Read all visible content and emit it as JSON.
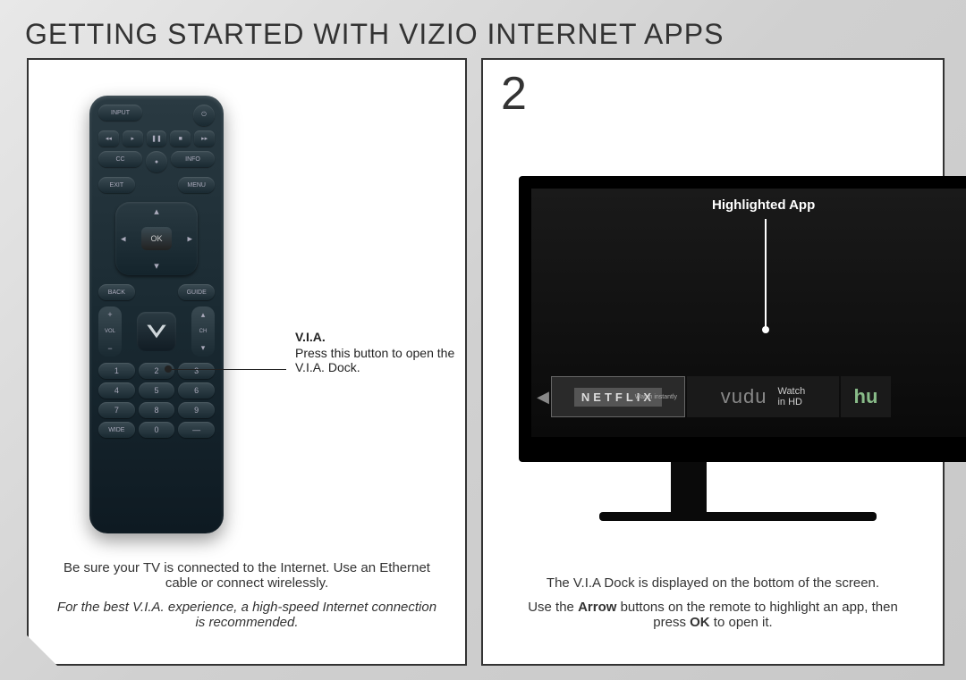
{
  "title": "GETTING STARTED WITH VIZIO INTERNET APPS",
  "panel1": {
    "callout": {
      "heading": "V.I.A.",
      "text": "Press this button to open the V.I.A. Dock."
    },
    "footer": {
      "line1": "Be sure your TV is connected to the Internet. Use an Ethernet cable or connect wirelessly.",
      "line2": "For the best V.I.A. experience, a high-speed Internet connection is recommended."
    },
    "remote": {
      "top": {
        "input": "INPUT",
        "power": "⏻"
      },
      "transport": {
        "rew": "◂◂",
        "play": "▸",
        "pause": "❚❚",
        "stop": "■",
        "ffwd": "▸▸"
      },
      "row3": {
        "cc": "CC",
        "rec": "●",
        "info": "INFO"
      },
      "row4": {
        "exit": "EXIT",
        "menu": "MENU"
      },
      "dpad": {
        "ok": "OK"
      },
      "row5": {
        "back": "BACK",
        "guide": "GUIDE"
      },
      "vol": {
        "label": "VOL",
        "plus": "+",
        "minus": "−"
      },
      "ch": {
        "label": "CH",
        "up": "▴",
        "down": "▾"
      },
      "via": "V",
      "numpad": [
        "1",
        "2",
        "3",
        "4",
        "5",
        "6",
        "7",
        "8",
        "9",
        "WIDE",
        "0",
        "—"
      ]
    }
  },
  "panel2": {
    "step": "2",
    "highlight_label": "Highlighted App",
    "dock": {
      "netflix": {
        "logo": "NETFLIX",
        "sub": "Watch instantly"
      },
      "vudu": {
        "logo": "vudu",
        "sub1": "Watch",
        "sub2": "in HD"
      },
      "hulu": {
        "logo": "hu"
      }
    },
    "footer": {
      "line1": "The V.I.A Dock is displayed on the bottom of the screen.",
      "line2a": "Use the ",
      "line2b": "Arrow",
      "line2c": " buttons on the remote to highlight an app, then press ",
      "line2d": "OK",
      "line2e": " to open it."
    }
  }
}
